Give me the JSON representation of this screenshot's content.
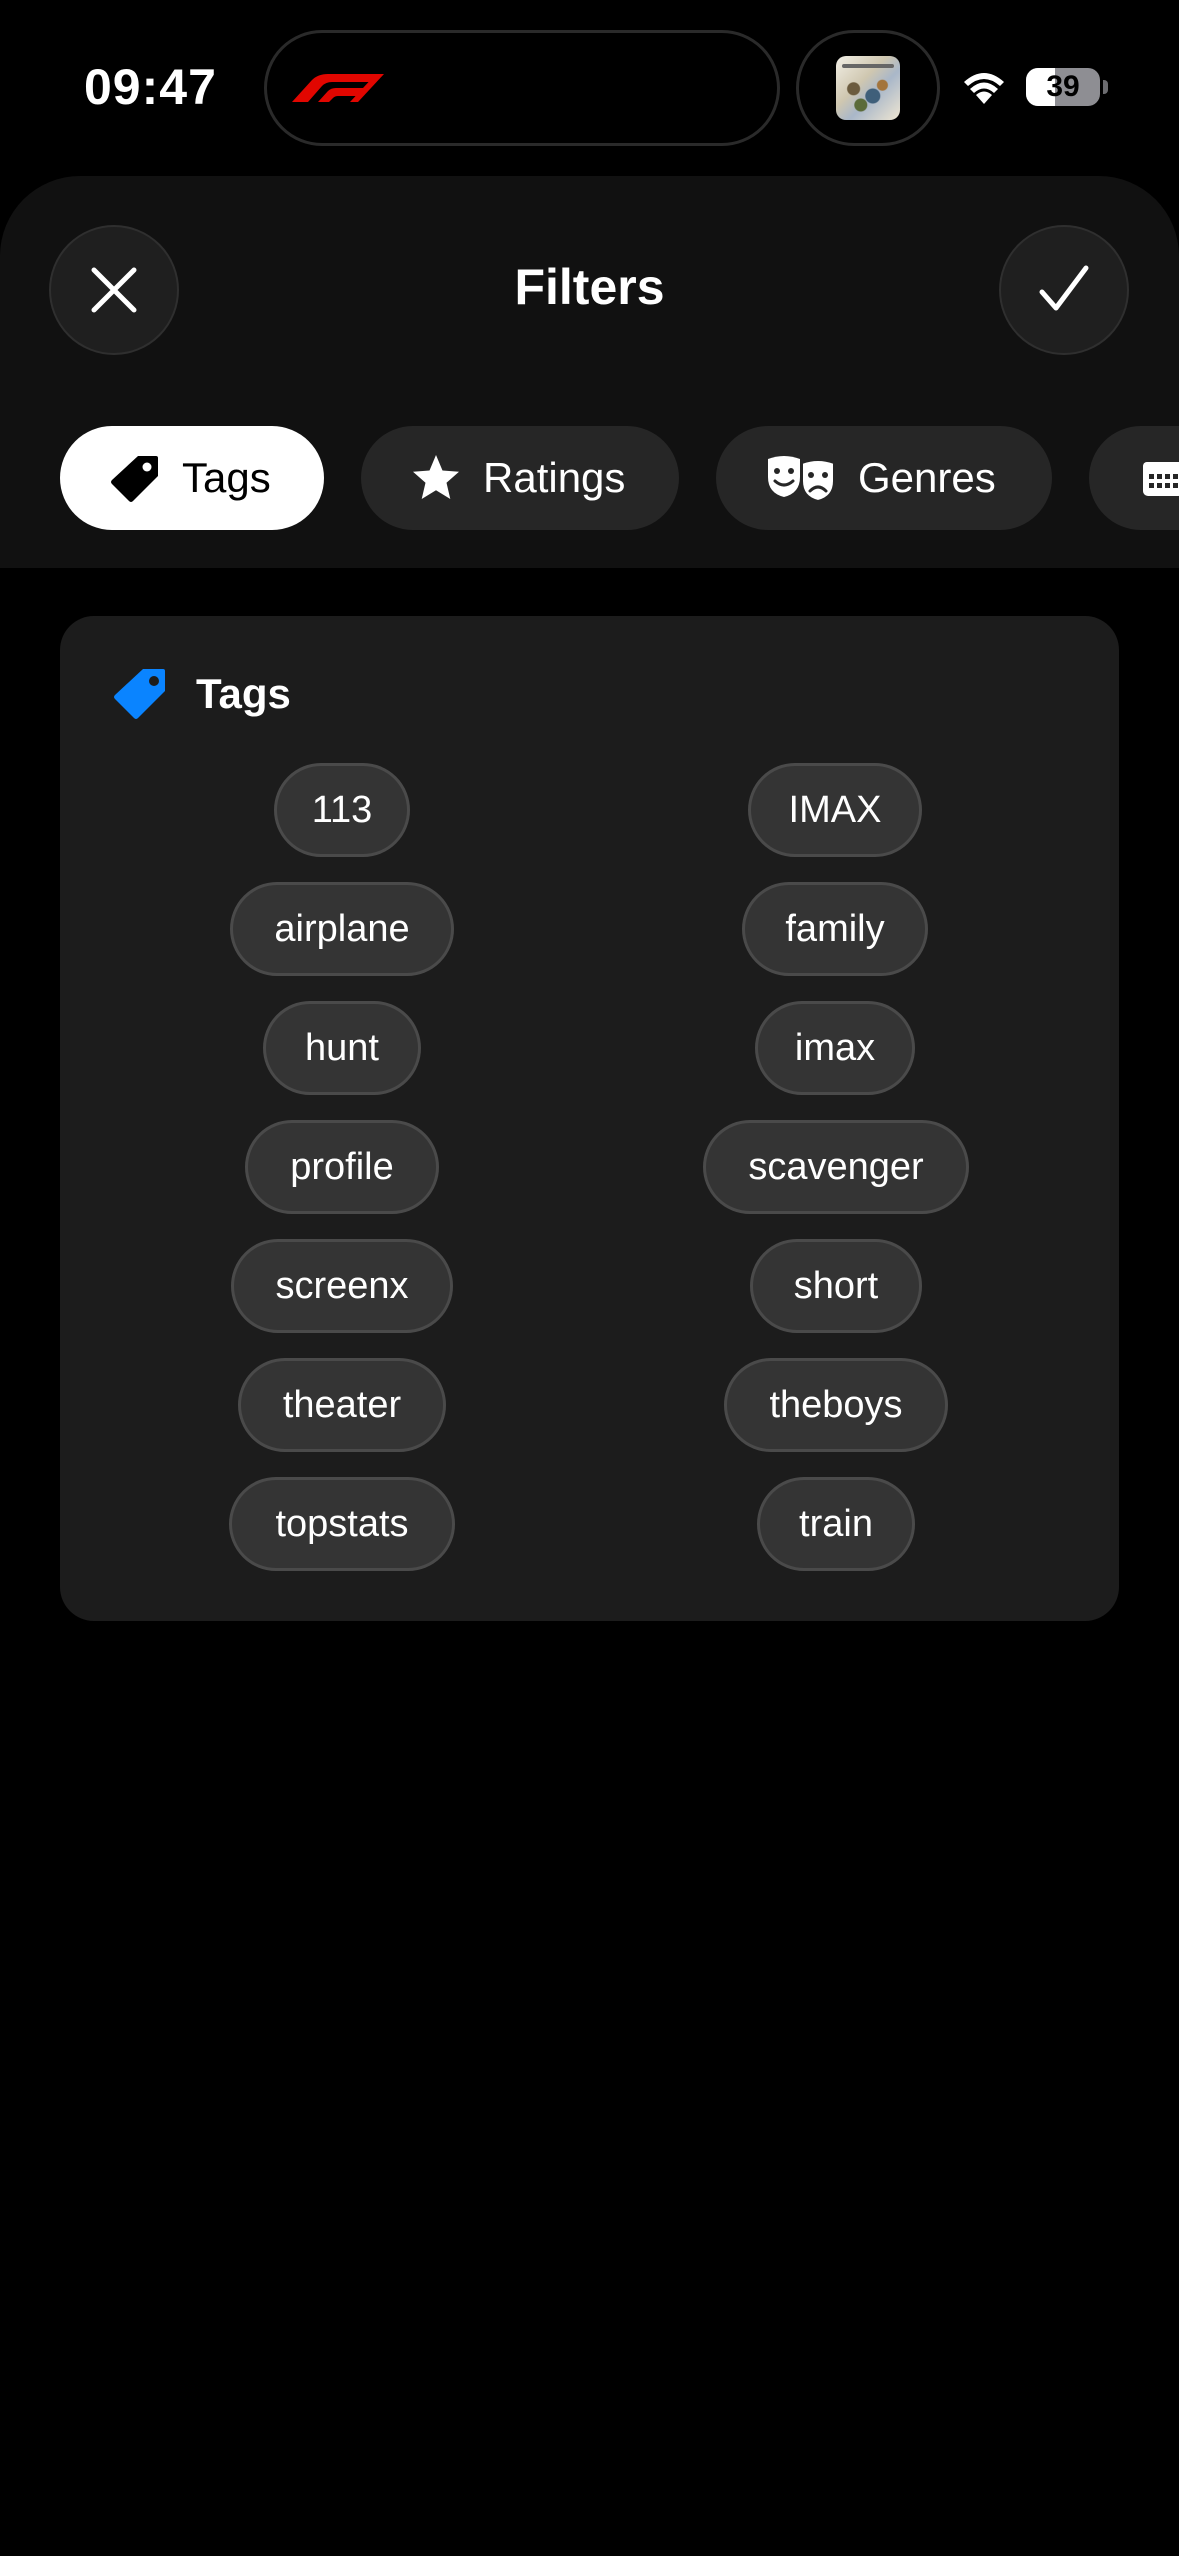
{
  "status_bar": {
    "time": "09:47",
    "battery_percent": "39",
    "battery_level": 0.39
  },
  "header": {
    "title": "Filters",
    "close_icon": "close-icon",
    "confirm_icon": "checkmark-icon"
  },
  "tabs": [
    {
      "label": "Tags",
      "icon": "tag-icon",
      "active": true
    },
    {
      "label": "Ratings",
      "icon": "star-icon",
      "active": false
    },
    {
      "label": "Genres",
      "icon": "theater-masks-icon",
      "active": false
    },
    {
      "label": "",
      "icon": "calendar-icon",
      "active": false
    }
  ],
  "tags_section": {
    "title": "Tags",
    "icon": "tag-icon",
    "accent_color": "#0A84FF",
    "tags": [
      "113",
      "IMAX",
      "airplane",
      "family",
      "hunt",
      "imax",
      "profile",
      "scavenger",
      "screenx",
      "short",
      "theater",
      "theboys",
      "topstats",
      "train"
    ]
  }
}
